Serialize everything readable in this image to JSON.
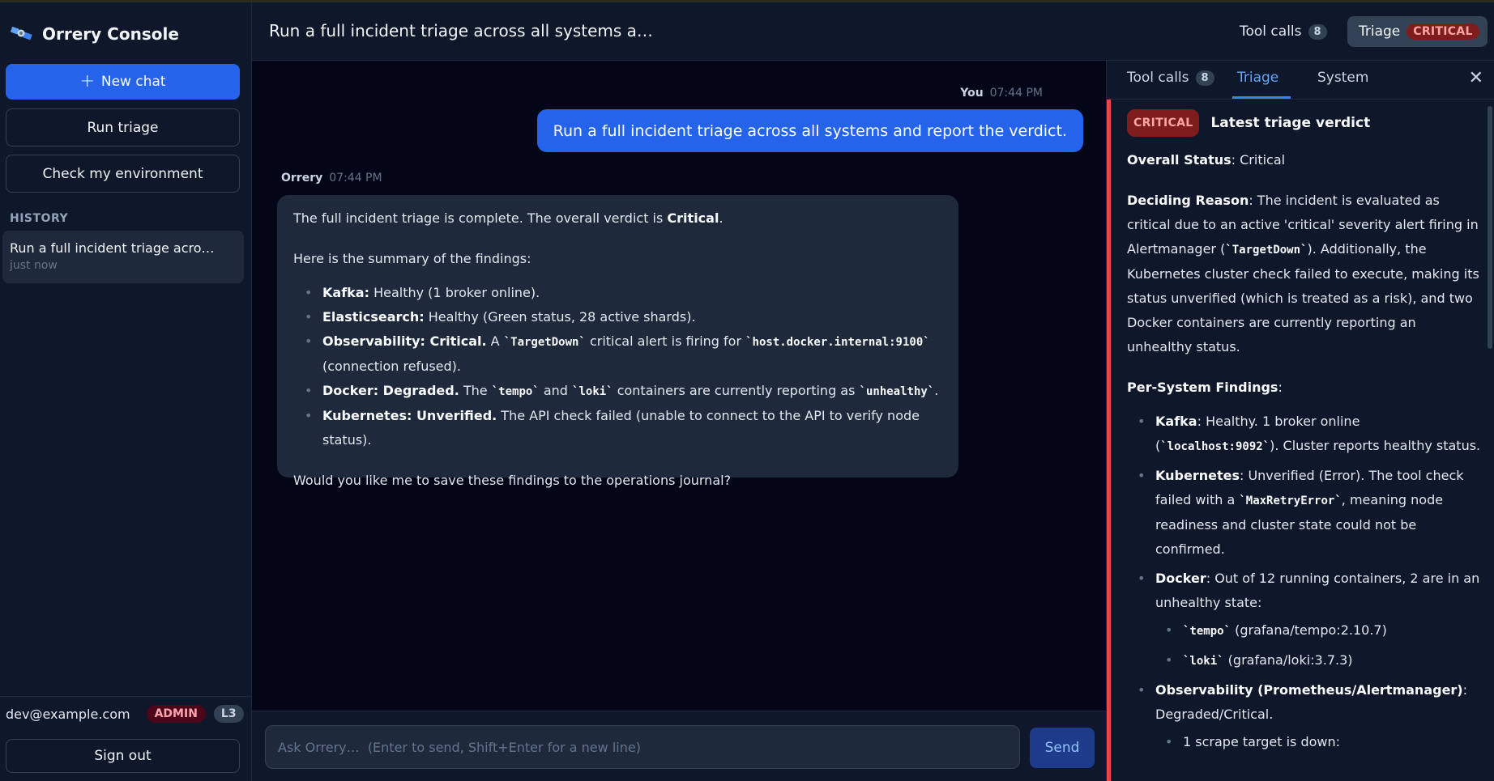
{
  "sidebar": {
    "brand": "Orrery Console",
    "new_chat": "New chat",
    "run_triage": "Run triage",
    "check_env": "Check my environment",
    "history_label": "HISTORY",
    "history": [
      {
        "title": "Run a full incident triage acro…",
        "time": "just now"
      }
    ],
    "user_email": "dev@example.com",
    "role_badge": "ADMIN",
    "level_badge": "L3",
    "sign_out": "Sign out"
  },
  "header": {
    "title": "Run a full incident triage across all systems a…",
    "tool_calls_label": "Tool calls",
    "tool_calls_count": "8",
    "triage_label": "Triage",
    "triage_status": "CRITICAL"
  },
  "chat": {
    "user_name": "You",
    "user_time": "07:44 PM",
    "user_message": "Run a full incident triage across all systems and report the verdict.",
    "bot_name": "Orrery",
    "bot_time": "07:44 PM",
    "bot": {
      "intro_pre": "The full incident triage is complete. The overall verdict is ",
      "intro_bold": "Critical",
      "intro_post": ".",
      "summary": "Here is the summary of the findings:",
      "kafka_label": "Kafka:",
      "kafka_text": " Healthy (1 broker online).",
      "es_label": "Elasticsearch:",
      "es_text": " Healthy (Green status, 28 active shards).",
      "obs_label": "Observability: Critical.",
      "obs_pre": " A ",
      "obs_code1": "`TargetDown`",
      "obs_mid": " critical alert is firing for ",
      "obs_code2": "`host.docker.internal:9100`",
      "obs_post": " (connection refused).",
      "docker_label": "Docker: Degraded.",
      "docker_pre": " The ",
      "docker_code1": "`tempo`",
      "docker_mid": " and ",
      "docker_code2": "`loki`",
      "docker_mid2": " containers are currently reporting as ",
      "docker_code3": "`unhealthy`",
      "docker_post": ".",
      "k8s_label": "Kubernetes: Unverified.",
      "k8s_text": " The API check failed (unable to connect to the API to verify node status).",
      "closing": "Would you like me to save these findings to the operations journal?"
    },
    "input_placeholder": "Ask Orrery…  (Enter to send, Shift+Enter for a new line)",
    "send": "Send"
  },
  "panel": {
    "tabs": [
      {
        "label": "Tool calls",
        "count": "8"
      },
      {
        "label": "Triage"
      },
      {
        "label": "System"
      }
    ],
    "close": "✕",
    "verdict_badge": "CRITICAL",
    "verdict_title": "Latest triage verdict",
    "overall_label": "Overall Status",
    "overall_value": ": Critical",
    "reason_label": "Deciding Reason",
    "reason_pre": ": The incident is evaluated as critical due to an active 'critical' severity alert firing in Alertmanager (",
    "reason_code": "`TargetDown`",
    "reason_post": "). Additionally, the Kubernetes cluster check failed to execute, making its status unverified (which is treated as a risk), and two Docker containers are currently reporting an unhealthy status.",
    "findings_label": "Per-System Findings",
    "findings_colon": ":",
    "kafka_label": "Kafka",
    "kafka_pre": ": Healthy. 1 broker online (",
    "kafka_code": "`localhost:9092`",
    "kafka_post": "). Cluster reports healthy status.",
    "k8s_label": "Kubernetes",
    "k8s_pre": ": Unverified (Error). The tool check failed with a ",
    "k8s_code": "`MaxRetryError`",
    "k8s_post": ", meaning node readiness and cluster state could not be confirmed.",
    "docker_label": "Docker",
    "docker_text": ": Out of 12 running containers, 2 are in an unhealthy state:",
    "docker_items": [
      {
        "code": "`tempo`",
        "text": " (grafana/tempo:2.10.7)"
      },
      {
        "code": "`loki`",
        "text": " (grafana/loki:3.7.3)"
      }
    ],
    "obs_label": "Observability (Prometheus/Alertmanager)",
    "obs_text": ": Degraded/Critical.",
    "obs_sub": "1 scrape target is down:"
  },
  "colors": {
    "accent": "#2563eb",
    "critical": "#ef4444",
    "background": "#020617",
    "surface": "#0f172a"
  }
}
